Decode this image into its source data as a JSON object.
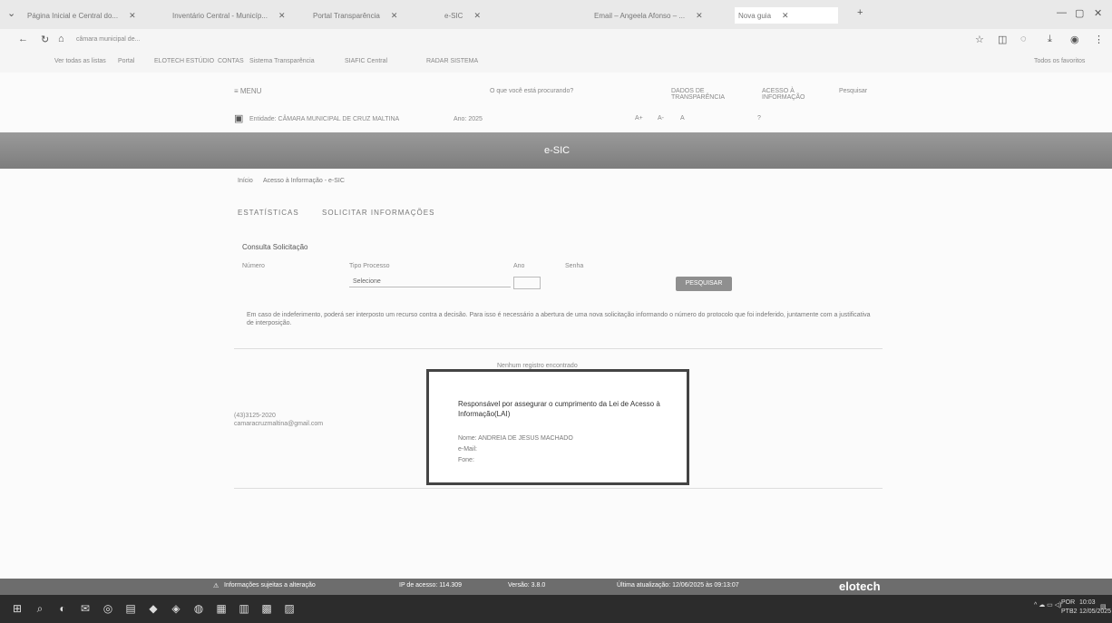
{
  "browser": {
    "tabs": [
      {
        "label": "Página Inicial e Central do..."
      },
      {
        "label": "Inventário Central - Municíp..."
      },
      {
        "label": "Portal Transparência"
      },
      {
        "label": "e-SIC"
      },
      {
        "label": "Email – Angeela Afonso – ..."
      },
      {
        "label": "Nova guia"
      }
    ],
    "new_tab": "+",
    "address": "câmara municipal de...",
    "bookmarks": [
      "Ver todas as listas",
      "Portal",
      "ELOTECH ESTÚDIO",
      "CONTAS",
      "Sistema Transparência",
      "SIAFIC Central",
      "RADAR SISTEMA"
    ],
    "all_bookmarks": "Todos os favoritos"
  },
  "header": {
    "menu": "≡ MENU",
    "search_placeholder": "O que você está procurando?",
    "quick_links": [
      "DADOS DE TRANSPARÊNCIA",
      "ACESSO À INFORMAÇÃO",
      "Pesquisar"
    ],
    "entity_label": "Entidade: CÂMARA MUNICIPAL DE CRUZ MALTINA",
    "year_label": "Ano: 2025",
    "accessibility": [
      "A+",
      "A-",
      "A",
      "?"
    ]
  },
  "banner": {
    "title": "e-SIC"
  },
  "breadcrumb": {
    "home": "Início",
    "current": "Acesso à Informação - e-SIC"
  },
  "nav_tabs": [
    "ESTATÍSTICAS",
    "SOLICITAR INFORMAÇÕES"
  ],
  "form": {
    "section_title": "Consulta Solicitação",
    "protocol_label": "Número",
    "type_label": "Tipo Processo",
    "type_value": "Selecione",
    "year_label": "Ano",
    "password_label": "Senha",
    "search_button": "PESQUISAR"
  },
  "notice": "Em caso de indeferimento, poderá ser interposto um recurso contra a decisão. Para isso é necessário a abertura de uma nova solicitação informando o número do protocolo que foi indeferido, juntamente com a justificativa de interposição.",
  "no_records": "Nenhum registro encontrado",
  "contact": {
    "phone": "(43)3125-2020",
    "email": "camaracruzmaltina@gmail.com"
  },
  "modal": {
    "title": "Responsável por assegurar o cumprimento da Lei de Acesso à Informação(LAI)",
    "name": "Nome: ANDREIA DE JESUS MACHADO",
    "email": "e-Mail:",
    "phone": "Fone:"
  },
  "status_bar": {
    "info": "Informações sujeitas a alteração",
    "ip": "IP de acesso: 114.309",
    "version": "Versão: 3.8.0",
    "updated": "Última atualização: 12/06/2025 às 09:13:07",
    "brand": "elotech"
  },
  "taskbar": {
    "lang": "POR",
    "kbd": "PTB2",
    "time": "10:03",
    "date": "12/05/2025"
  },
  "colors": {
    "banner": "#8a8a8a",
    "status_bar": "#6d6d6d",
    "taskbar": "#2c2c2c"
  }
}
